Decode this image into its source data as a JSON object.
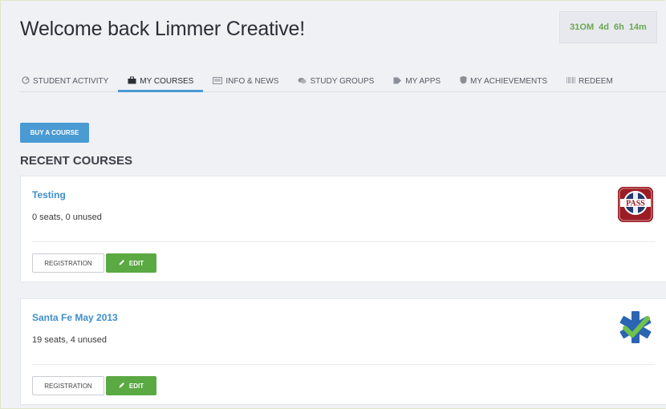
{
  "header": {
    "title": "Welcome back Limmer Creative!",
    "timer": {
      "months": "31OM",
      "days": "4d",
      "hours": "6h",
      "minutes": "14m"
    }
  },
  "tabs": [
    {
      "label": "STUDENT ACTIVITY",
      "icon": "gauge-icon",
      "active": false
    },
    {
      "label": "MY COURSES",
      "icon": "briefcase-icon",
      "active": true
    },
    {
      "label": "INFO & NEWS",
      "icon": "newspaper-icon",
      "active": false
    },
    {
      "label": "STUDY GROUPS",
      "icon": "chat-icon",
      "active": false
    },
    {
      "label": "MY APPS",
      "icon": "tags-icon",
      "active": false
    },
    {
      "label": "MY ACHIEVEMENTS",
      "icon": "shield-icon",
      "active": false
    },
    {
      "label": "REDEEM",
      "icon": "barcode-icon",
      "active": false
    }
  ],
  "buy_button": "BUY A COURSE",
  "section_title": "RECENT COURSES",
  "courses": [
    {
      "title": "Testing",
      "meta": "0 seats, 0 unused",
      "registration_label": "REGISTRATION",
      "edit_label": "EDIT",
      "logo_text": "PASS",
      "logo_icon": "pass-logo-icon"
    },
    {
      "title": "Santa Fe May 2013",
      "meta": "19 seats, 4 unused",
      "registration_label": "REGISTRATION",
      "edit_label": "EDIT",
      "logo_icon": "star-of-life-check-icon"
    }
  ],
  "colors": {
    "accent_blue": "#4a9bd4",
    "edit_green": "#5aa942",
    "timer_green": "#6aa84f"
  }
}
